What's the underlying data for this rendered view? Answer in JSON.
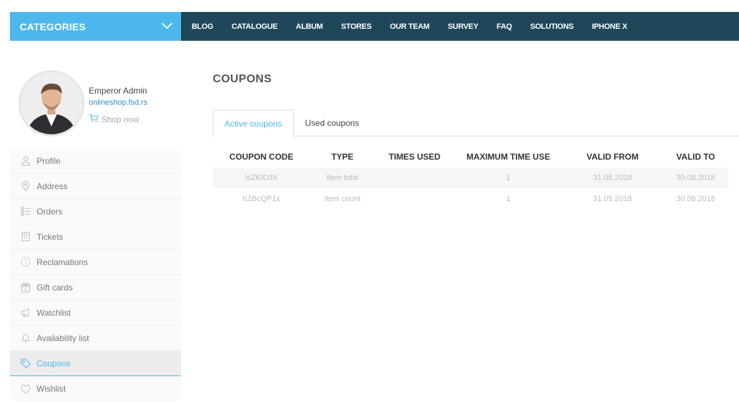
{
  "header": {
    "categories_label": "CATEGORIES",
    "nav": [
      "BLOG",
      "CATALOGUE",
      "ALBUM",
      "STORES",
      "OUR TEAM",
      "SURVEY",
      "FAQ",
      "SOLUTIONS",
      "IPHONE X"
    ]
  },
  "profile": {
    "name": "Emperor Admin",
    "link": "onlineshop.fsd.rs",
    "shop_now": "Shop now"
  },
  "sidebar": {
    "items": [
      {
        "label": "Profile",
        "icon": "user-icon"
      },
      {
        "label": "Address",
        "icon": "map-pin-icon"
      },
      {
        "label": "Orders",
        "icon": "list-icon"
      },
      {
        "label": "Tickets",
        "icon": "ticket-icon"
      },
      {
        "label": "Reclamations",
        "icon": "info-icon"
      },
      {
        "label": "Gift cards",
        "icon": "gift-icon"
      },
      {
        "label": "Watchlist",
        "icon": "megaphone-icon"
      },
      {
        "label": "Availability list",
        "icon": "bell-icon"
      },
      {
        "label": "Coupons",
        "icon": "tag-icon",
        "active": true
      },
      {
        "label": "Wishlist",
        "icon": "heart-icon"
      }
    ]
  },
  "main": {
    "title": "COUPONS",
    "tabs": [
      {
        "label": "Active coupons",
        "active": true
      },
      {
        "label": "Used coupons",
        "active": false
      }
    ],
    "table": {
      "headers": [
        "COUPON CODE",
        "TYPE",
        "TIMES USED",
        "MAXIMUM TIME USE",
        "VALID FROM",
        "VALID TO"
      ],
      "rows": [
        [
          "IsZKID3X",
          "Item total",
          "",
          "1",
          "31.05.2018",
          "30.08.2018"
        ],
        [
          "hZBcQP1x",
          "Item count",
          "",
          "1",
          "31.05.2018",
          "30.08.2018"
        ]
      ]
    }
  },
  "colors": {
    "accent": "#4db8ee",
    "navbar": "#1f4759",
    "link": "#2d8fce"
  }
}
